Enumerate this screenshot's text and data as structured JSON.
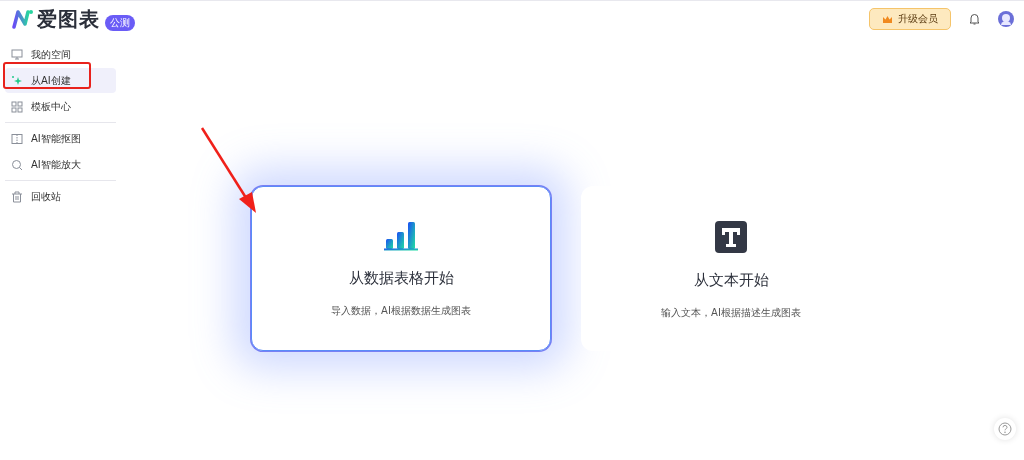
{
  "header": {
    "logo": "爱图表",
    "badge": "公测",
    "upgrade_button": "升级会员"
  },
  "sidebar": {
    "sections": [
      {
        "items": [
          {
            "label": "我的空间",
            "kind": "monitor",
            "selected": false
          },
          {
            "label": "从AI创建",
            "kind": "sparkle",
            "selected": true
          },
          {
            "label": "模板中心",
            "kind": "grid",
            "selected": false
          }
        ]
      },
      {
        "items": [
          {
            "label": "AI智能抠图",
            "kind": "cutout",
            "selected": false
          },
          {
            "label": "AI智能放大",
            "kind": "magnifier",
            "selected": false
          }
        ]
      },
      {
        "items": [
          {
            "label": "回收站",
            "kind": "trash",
            "selected": false
          }
        ]
      }
    ]
  },
  "cards": [
    {
      "kind": "chart",
      "title": "从数据表格开始",
      "description": "导入数据，AI根据数据生成图表",
      "selected": true
    },
    {
      "kind": "text",
      "title": "从文本开始",
      "description": "输入文本，AI根据描述生成图表",
      "selected": false
    }
  ]
}
